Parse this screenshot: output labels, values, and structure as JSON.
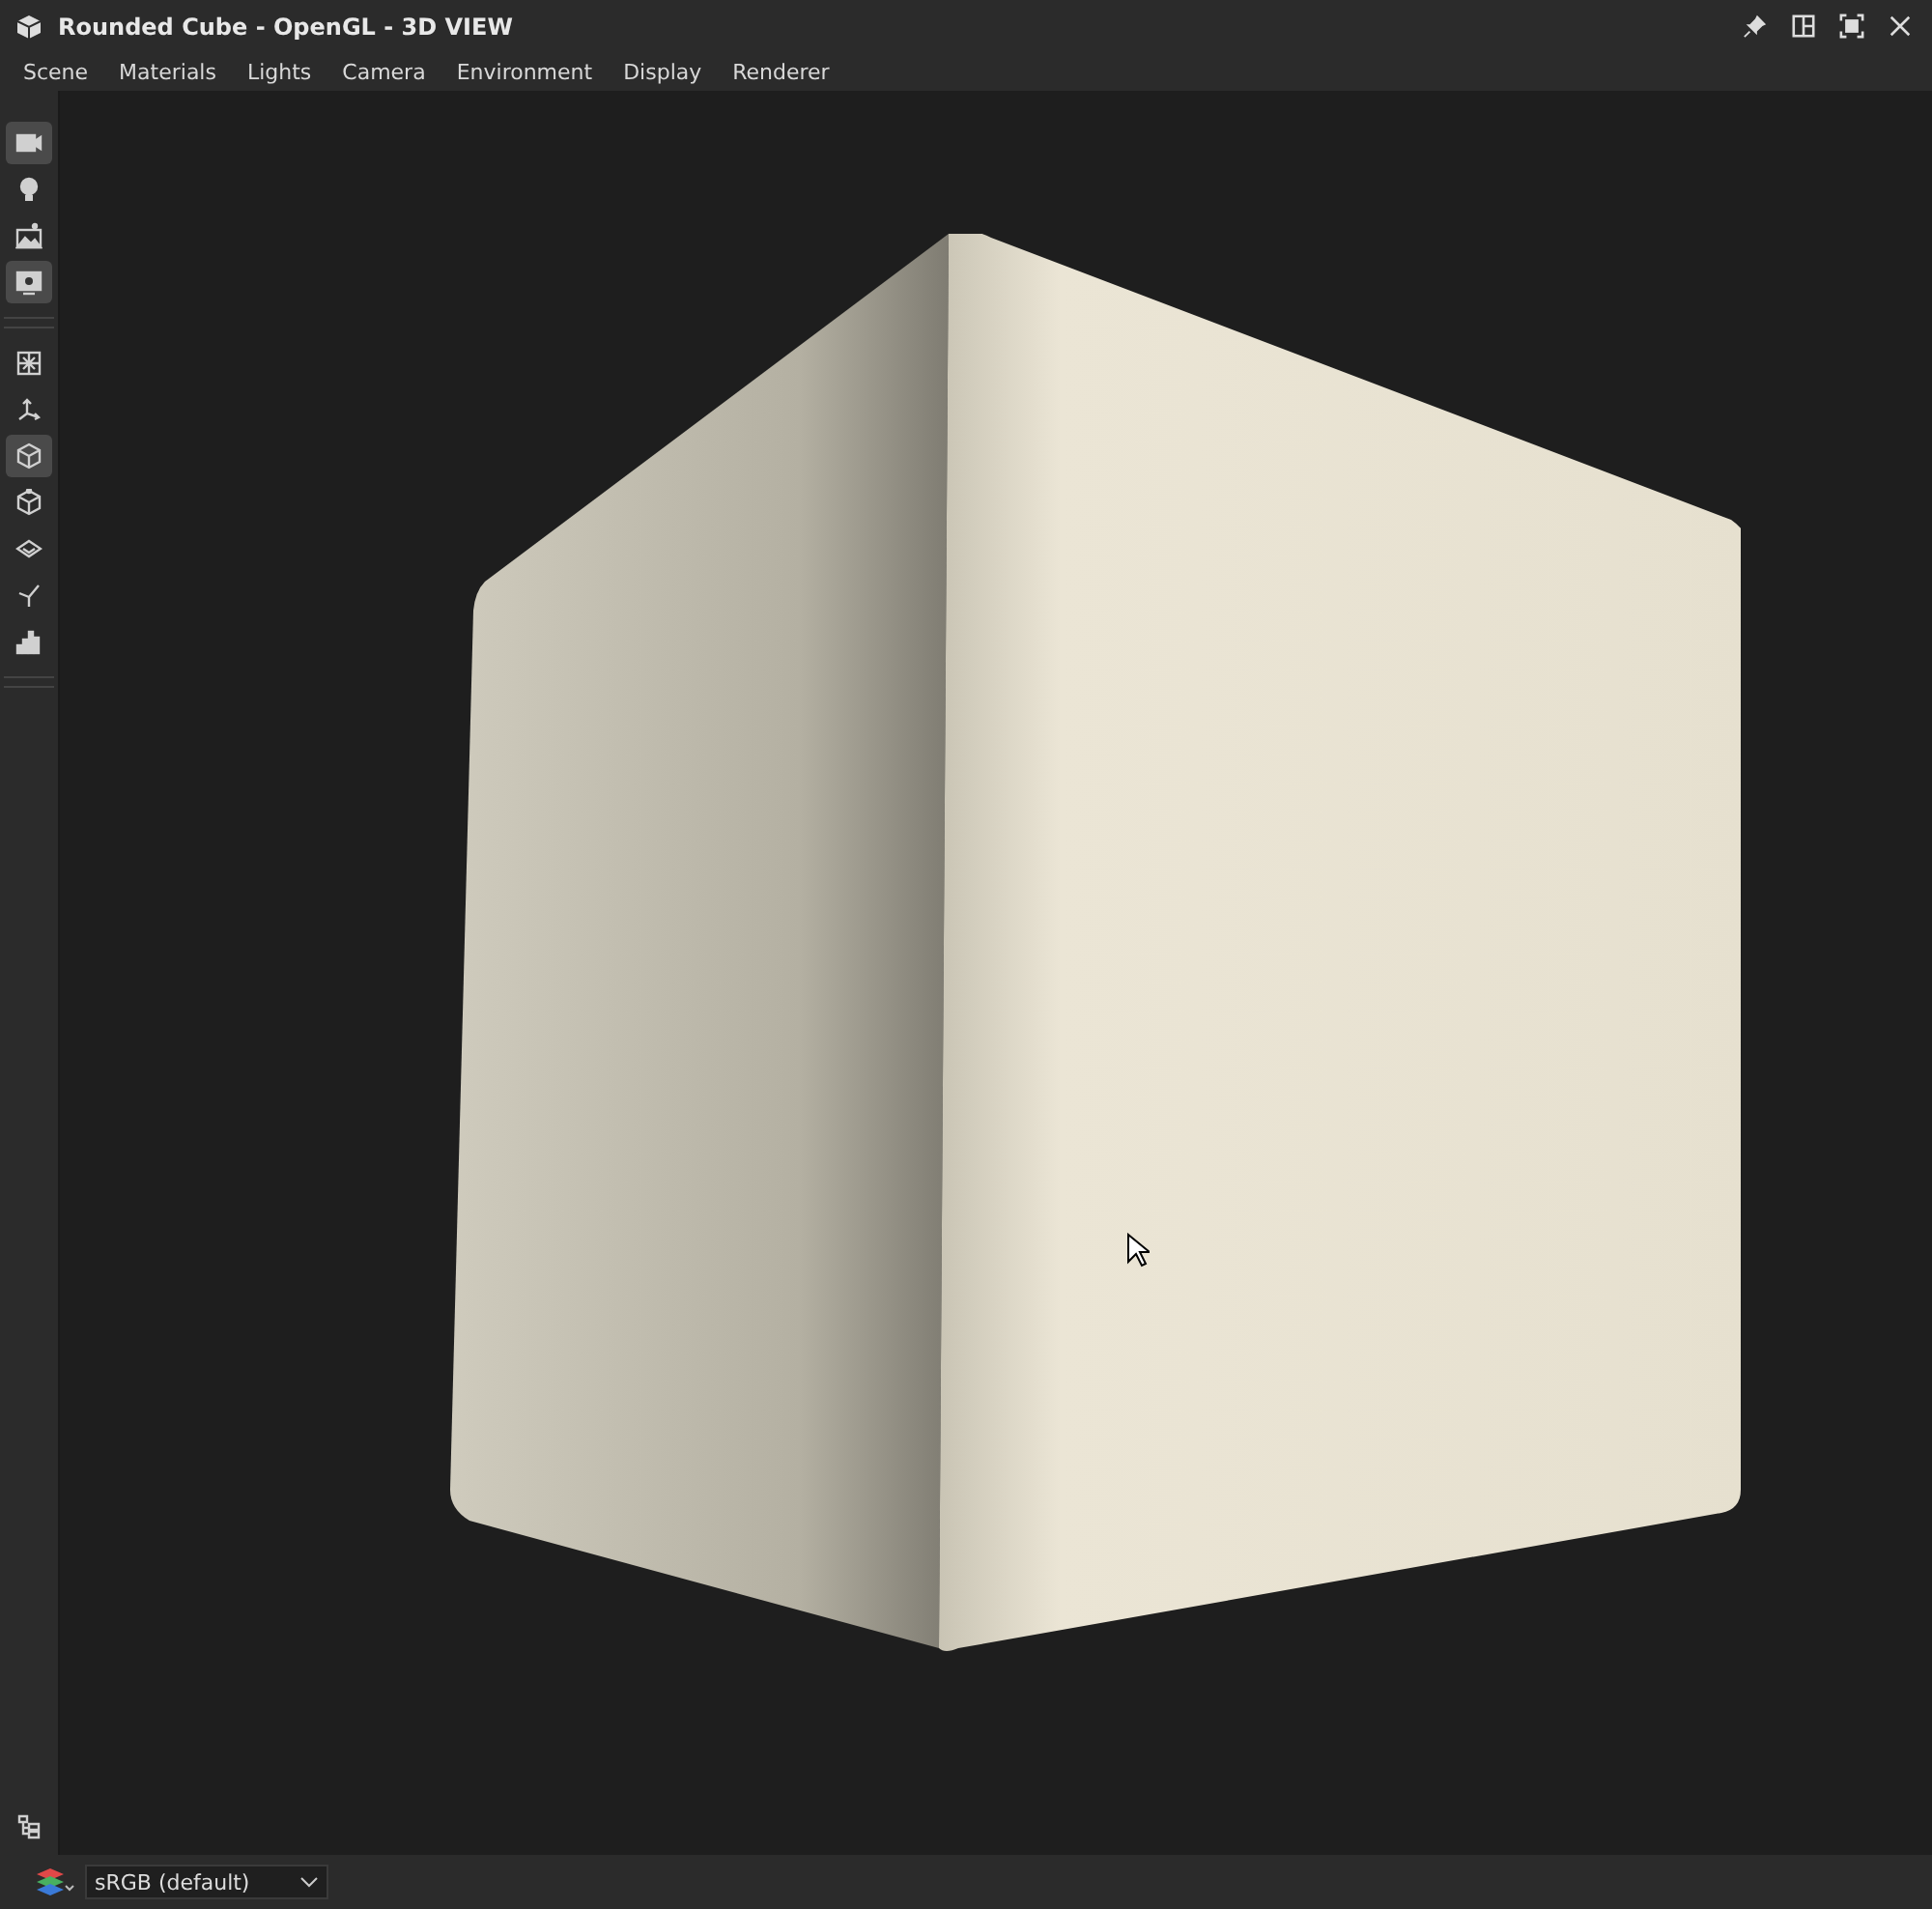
{
  "window": {
    "title": "Rounded Cube - OpenGL - 3D VIEW"
  },
  "menu": [
    "Scene",
    "Materials",
    "Lights",
    "Camera",
    "Environment",
    "Display",
    "Renderer"
  ],
  "tools": [
    {
      "kind": "camera",
      "selected": true
    },
    {
      "kind": "bulb",
      "selected": false
    },
    {
      "kind": "landscape",
      "selected": false
    },
    {
      "kind": "screen",
      "selected": true
    },
    {
      "kind": "divider"
    },
    {
      "kind": "grid",
      "selected": false
    },
    {
      "kind": "axes",
      "selected": false
    },
    {
      "kind": "cube",
      "selected": true
    },
    {
      "kind": "cubeframe",
      "selected": false
    },
    {
      "kind": "layers",
      "selected": false
    },
    {
      "kind": "tripod",
      "selected": false
    },
    {
      "kind": "histogram",
      "selected": false
    },
    {
      "kind": "divider"
    }
  ],
  "status_bar": {
    "colorspace": "sRGB (default)"
  }
}
